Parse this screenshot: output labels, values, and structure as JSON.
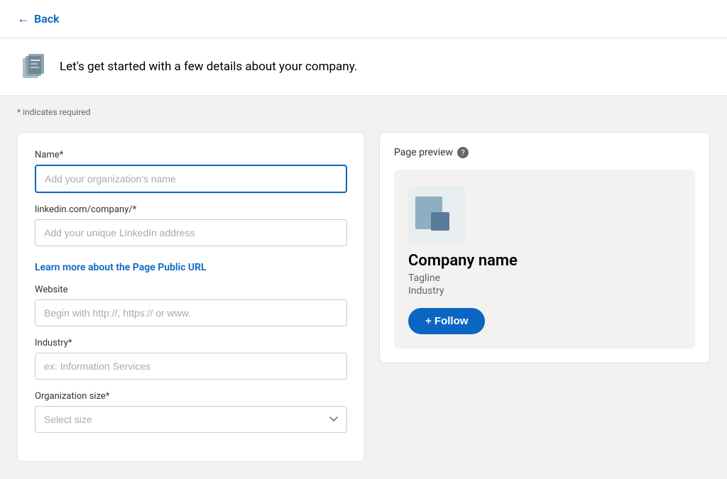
{
  "nav": {
    "back_label": "Back"
  },
  "header": {
    "text": "Let's get started with a few details about your company."
  },
  "form": {
    "required_note": "* indicates required",
    "name_label": "Name*",
    "name_placeholder": "Add your organization's name",
    "url_label": "linkedin.com/company/*",
    "url_placeholder": "Add your unique LinkedIn address",
    "learn_more_text": "Learn more about the Page Public URL",
    "website_label": "Website",
    "website_placeholder": "Begin with http://, https:// or www.",
    "industry_label": "Industry*",
    "industry_placeholder": "ex: Information Services",
    "org_size_label": "Organization size*",
    "org_size_placeholder": "Select size"
  },
  "preview": {
    "title": "Page preview",
    "help_icon_label": "?",
    "company_name": "Company name",
    "tagline": "Tagline",
    "industry": "Industry",
    "follow_button": "+ Follow"
  }
}
